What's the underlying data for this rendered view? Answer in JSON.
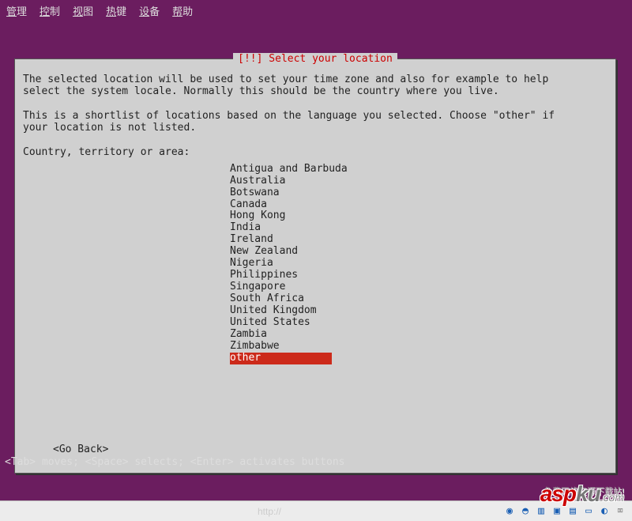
{
  "menubar": {
    "items": [
      "管理",
      "控制",
      "视图",
      "热键",
      "设备",
      "帮助"
    ]
  },
  "dialog": {
    "title": "[!!] Select your location",
    "para1": "The selected location will be used to set your time zone and also for example to help\nselect the system locale. Normally this should be the country where you live.",
    "para2": "This is a shortlist of locations based on the language you selected. Choose \"other\" if\nyour location is not listed.",
    "prompt": "Country, territory or area:",
    "locations": [
      "Antigua and Barbuda",
      "Australia",
      "Botswana",
      "Canada",
      "Hong Kong",
      "India",
      "Ireland",
      "New Zealand",
      "Nigeria",
      "Philippines",
      "Singapore",
      "South Africa",
      "United Kingdom",
      "United States",
      "Zambia",
      "Zimbabwe",
      "other"
    ],
    "selected_index": 16,
    "go_back": "<Go Back>"
  },
  "hint": "<Tab> moves; <Space> selects; <Enter> activates buttons",
  "status": {
    "url": "http://",
    "watermark_a": "asp",
    "watermark_b": "ku",
    "watermark_dom": ".com",
    "watermark_sub": "免费网络资源下载站!"
  }
}
